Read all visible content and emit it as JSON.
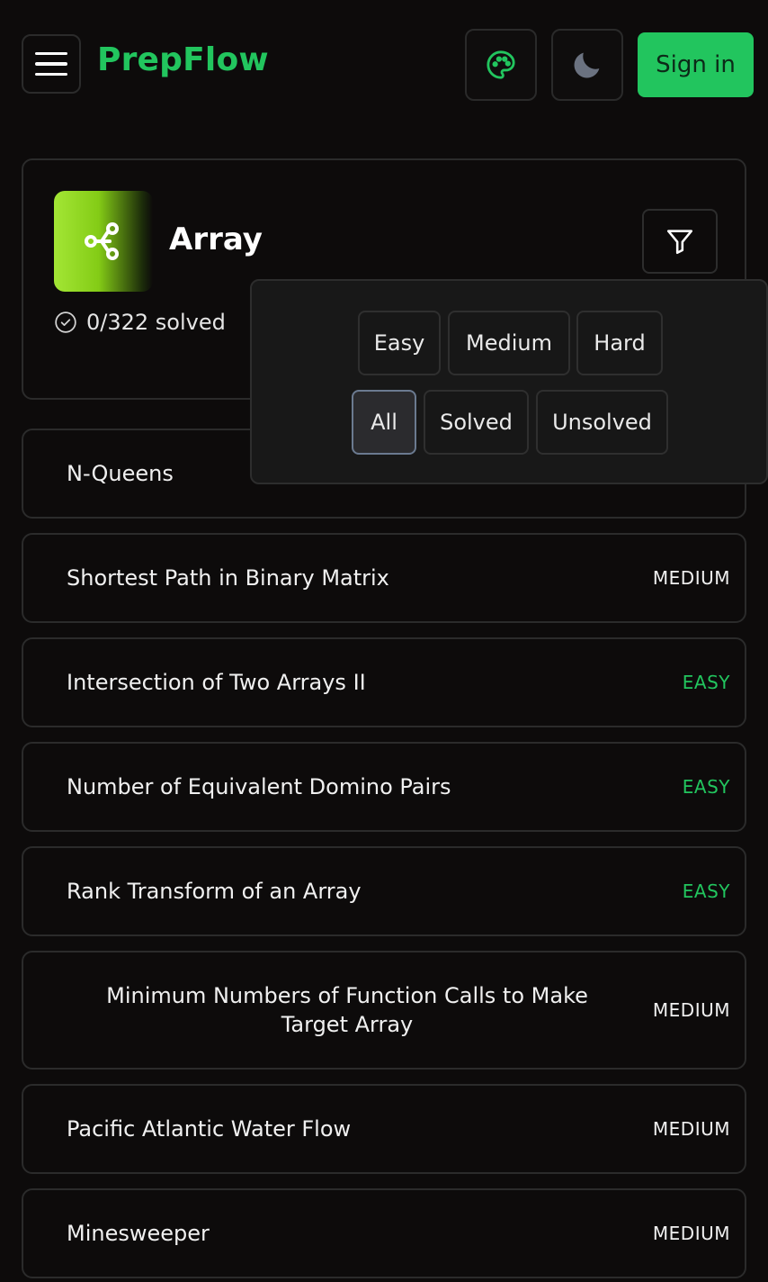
{
  "header": {
    "brand": "PrepFlow",
    "signin_label": "Sign in",
    "menu_icon": "hamburger-menu-icon",
    "palette_icon": "palette-icon",
    "theme_icon": "moon-icon"
  },
  "category": {
    "title": "Array",
    "icon": "share-nodes-icon",
    "solved_text": "0/322 solved",
    "filter_icon": "filter-funnel-icon"
  },
  "filters": {
    "difficulty": [
      "Easy",
      "Medium",
      "Hard"
    ],
    "status": [
      "All",
      "Solved",
      "Unsolved"
    ],
    "active_status": "All"
  },
  "problems": [
    {
      "title": "N-Queens",
      "difficulty": ""
    },
    {
      "title": "Shortest Path in Binary Matrix",
      "difficulty": "MEDIUM"
    },
    {
      "title": "Intersection of Two Arrays II",
      "difficulty": "EASY"
    },
    {
      "title": "Number of Equivalent Domino Pairs",
      "difficulty": "EASY"
    },
    {
      "title": "Rank Transform of an Array",
      "difficulty": "EASY"
    },
    {
      "title": "Minimum Numbers of Function Calls to Make Target Array",
      "difficulty": "MEDIUM"
    },
    {
      "title": "Pacific Atlantic Water Flow",
      "difficulty": "MEDIUM"
    },
    {
      "title": "Minesweeper",
      "difficulty": "MEDIUM"
    }
  ],
  "colors": {
    "accent": "#22c55e",
    "background": "#0d0b0b",
    "border": "#2b2b2b",
    "easy": "#22c55e",
    "medium": "#f0f0f0"
  }
}
